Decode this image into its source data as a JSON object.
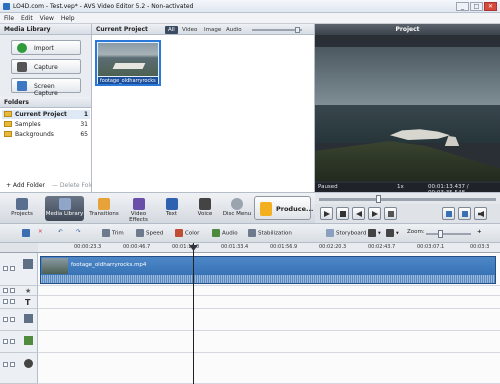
{
  "window": {
    "title": "LO4D.com - Test.vep* - AVS Video Editor 5.2 - Non-activated",
    "minimize": "_",
    "maximize": "□",
    "close": "✕"
  },
  "menu": [
    "File",
    "Edit",
    "View",
    "Help"
  ],
  "media_library": {
    "title": "Media Library",
    "buttons": [
      "Import",
      "Capture",
      "Screen Capture"
    ]
  },
  "folders": {
    "title": "Folders",
    "items": [
      {
        "name": "Current Project",
        "count": "1"
      },
      {
        "name": "Samples",
        "count": "31"
      },
      {
        "name": "Backgrounds",
        "count": "65"
      }
    ],
    "add_label": "+ Add Folder",
    "delete_label": "— Delete Folder"
  },
  "current_project": {
    "title": "Current Project",
    "tabs": [
      "All",
      "Video",
      "Image",
      "Audio"
    ],
    "active_tab": "All",
    "clip_name": "footage_oldharryrocks"
  },
  "project": {
    "title": "Project",
    "status": "Paused",
    "speed": "1x",
    "time": "00:01:13.437 / 00:03:35.548"
  },
  "toolbar": {
    "buttons": [
      "Projects",
      "Media Library",
      "Transitions",
      "Video Effects",
      "Text",
      "Voice",
      "Disc Menu"
    ],
    "active": "Media Library",
    "produce": "Produce..."
  },
  "timeline_toolbar": {
    "tools": [
      "Trim",
      "Speed",
      "Color",
      "Audio",
      "Stabilization"
    ],
    "storyboard": "Storyboard",
    "zoom": "Zoom:"
  },
  "ruler": [
    "00:00:23.3",
    "00:00:46.7",
    "00:01:10.0",
    "00:01:33.4",
    "00:01:56.9",
    "00:02:20.3",
    "00:02:43.7",
    "00:03:07.1",
    "00:03:3"
  ],
  "timeline": {
    "clip_label": "footage_oldharryrocks.mp4"
  },
  "colors": {
    "accent": "#2a79d8",
    "clip": "#3b78bb",
    "toolbar_active": "#4a5464"
  }
}
